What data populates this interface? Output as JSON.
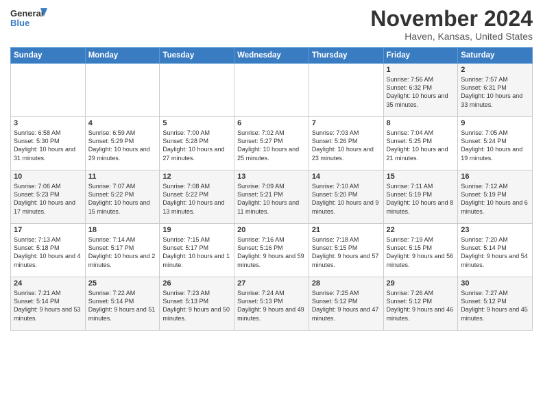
{
  "header": {
    "logo_line1": "General",
    "logo_line2": "Blue",
    "month": "November 2024",
    "location": "Haven, Kansas, United States"
  },
  "days_of_week": [
    "Sunday",
    "Monday",
    "Tuesday",
    "Wednesday",
    "Thursday",
    "Friday",
    "Saturday"
  ],
  "weeks": [
    [
      {
        "day": "",
        "info": ""
      },
      {
        "day": "",
        "info": ""
      },
      {
        "day": "",
        "info": ""
      },
      {
        "day": "",
        "info": ""
      },
      {
        "day": "",
        "info": ""
      },
      {
        "day": "1",
        "info": "Sunrise: 7:56 AM\nSunset: 6:32 PM\nDaylight: 10 hours and 35 minutes."
      },
      {
        "day": "2",
        "info": "Sunrise: 7:57 AM\nSunset: 6:31 PM\nDaylight: 10 hours and 33 minutes."
      }
    ],
    [
      {
        "day": "3",
        "info": "Sunrise: 6:58 AM\nSunset: 5:30 PM\nDaylight: 10 hours and 31 minutes."
      },
      {
        "day": "4",
        "info": "Sunrise: 6:59 AM\nSunset: 5:29 PM\nDaylight: 10 hours and 29 minutes."
      },
      {
        "day": "5",
        "info": "Sunrise: 7:00 AM\nSunset: 5:28 PM\nDaylight: 10 hours and 27 minutes."
      },
      {
        "day": "6",
        "info": "Sunrise: 7:02 AM\nSunset: 5:27 PM\nDaylight: 10 hours and 25 minutes."
      },
      {
        "day": "7",
        "info": "Sunrise: 7:03 AM\nSunset: 5:26 PM\nDaylight: 10 hours and 23 minutes."
      },
      {
        "day": "8",
        "info": "Sunrise: 7:04 AM\nSunset: 5:25 PM\nDaylight: 10 hours and 21 minutes."
      },
      {
        "day": "9",
        "info": "Sunrise: 7:05 AM\nSunset: 5:24 PM\nDaylight: 10 hours and 19 minutes."
      }
    ],
    [
      {
        "day": "10",
        "info": "Sunrise: 7:06 AM\nSunset: 5:23 PM\nDaylight: 10 hours and 17 minutes."
      },
      {
        "day": "11",
        "info": "Sunrise: 7:07 AM\nSunset: 5:22 PM\nDaylight: 10 hours and 15 minutes."
      },
      {
        "day": "12",
        "info": "Sunrise: 7:08 AM\nSunset: 5:22 PM\nDaylight: 10 hours and 13 minutes."
      },
      {
        "day": "13",
        "info": "Sunrise: 7:09 AM\nSunset: 5:21 PM\nDaylight: 10 hours and 11 minutes."
      },
      {
        "day": "14",
        "info": "Sunrise: 7:10 AM\nSunset: 5:20 PM\nDaylight: 10 hours and 9 minutes."
      },
      {
        "day": "15",
        "info": "Sunrise: 7:11 AM\nSunset: 5:19 PM\nDaylight: 10 hours and 8 minutes."
      },
      {
        "day": "16",
        "info": "Sunrise: 7:12 AM\nSunset: 5:19 PM\nDaylight: 10 hours and 6 minutes."
      }
    ],
    [
      {
        "day": "17",
        "info": "Sunrise: 7:13 AM\nSunset: 5:18 PM\nDaylight: 10 hours and 4 minutes."
      },
      {
        "day": "18",
        "info": "Sunrise: 7:14 AM\nSunset: 5:17 PM\nDaylight: 10 hours and 2 minutes."
      },
      {
        "day": "19",
        "info": "Sunrise: 7:15 AM\nSunset: 5:17 PM\nDaylight: 10 hours and 1 minute."
      },
      {
        "day": "20",
        "info": "Sunrise: 7:16 AM\nSunset: 5:16 PM\nDaylight: 9 hours and 59 minutes."
      },
      {
        "day": "21",
        "info": "Sunrise: 7:18 AM\nSunset: 5:15 PM\nDaylight: 9 hours and 57 minutes."
      },
      {
        "day": "22",
        "info": "Sunrise: 7:19 AM\nSunset: 5:15 PM\nDaylight: 9 hours and 56 minutes."
      },
      {
        "day": "23",
        "info": "Sunrise: 7:20 AM\nSunset: 5:14 PM\nDaylight: 9 hours and 54 minutes."
      }
    ],
    [
      {
        "day": "24",
        "info": "Sunrise: 7:21 AM\nSunset: 5:14 PM\nDaylight: 9 hours and 53 minutes."
      },
      {
        "day": "25",
        "info": "Sunrise: 7:22 AM\nSunset: 5:14 PM\nDaylight: 9 hours and 51 minutes."
      },
      {
        "day": "26",
        "info": "Sunrise: 7:23 AM\nSunset: 5:13 PM\nDaylight: 9 hours and 50 minutes."
      },
      {
        "day": "27",
        "info": "Sunrise: 7:24 AM\nSunset: 5:13 PM\nDaylight: 9 hours and 49 minutes."
      },
      {
        "day": "28",
        "info": "Sunrise: 7:25 AM\nSunset: 5:12 PM\nDaylight: 9 hours and 47 minutes."
      },
      {
        "day": "29",
        "info": "Sunrise: 7:26 AM\nSunset: 5:12 PM\nDaylight: 9 hours and 46 minutes."
      },
      {
        "day": "30",
        "info": "Sunrise: 7:27 AM\nSunset: 5:12 PM\nDaylight: 9 hours and 45 minutes."
      }
    ]
  ]
}
